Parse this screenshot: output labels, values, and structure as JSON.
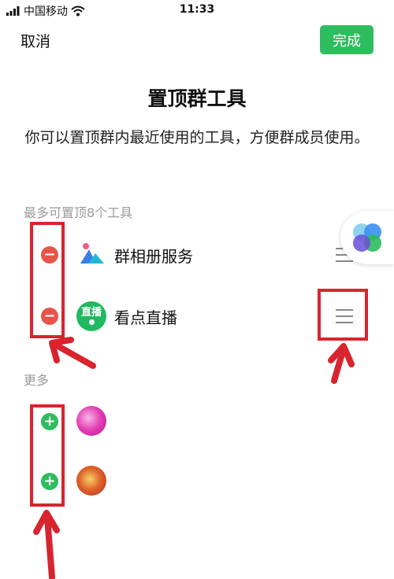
{
  "status_bar": {
    "carrier": "中国移动",
    "time": "11:33",
    "wifi_icon": "wifi-icon"
  },
  "nav": {
    "cancel_label": "取消",
    "done_label": "完成"
  },
  "colors": {
    "accent": "#2ebd5e",
    "remove": "#e8534a",
    "annotation": "#d8242e"
  },
  "title": "置顶群工具",
  "description": "你可以置顶群内最近使用的工具，方便群成员使用。",
  "pinned_section": {
    "label": "最多可置顶8个工具",
    "items": [
      {
        "label": "群相册服务",
        "icon": "photo-album-icon"
      },
      {
        "label": "看点直播",
        "icon": "live-icon",
        "icon_text": "直播"
      }
    ]
  },
  "more_section": {
    "label": "更多",
    "items": [
      {
        "label": "",
        "icon": "app-avatar-icon"
      },
      {
        "label": "",
        "icon": "app-avatar-icon"
      }
    ]
  }
}
